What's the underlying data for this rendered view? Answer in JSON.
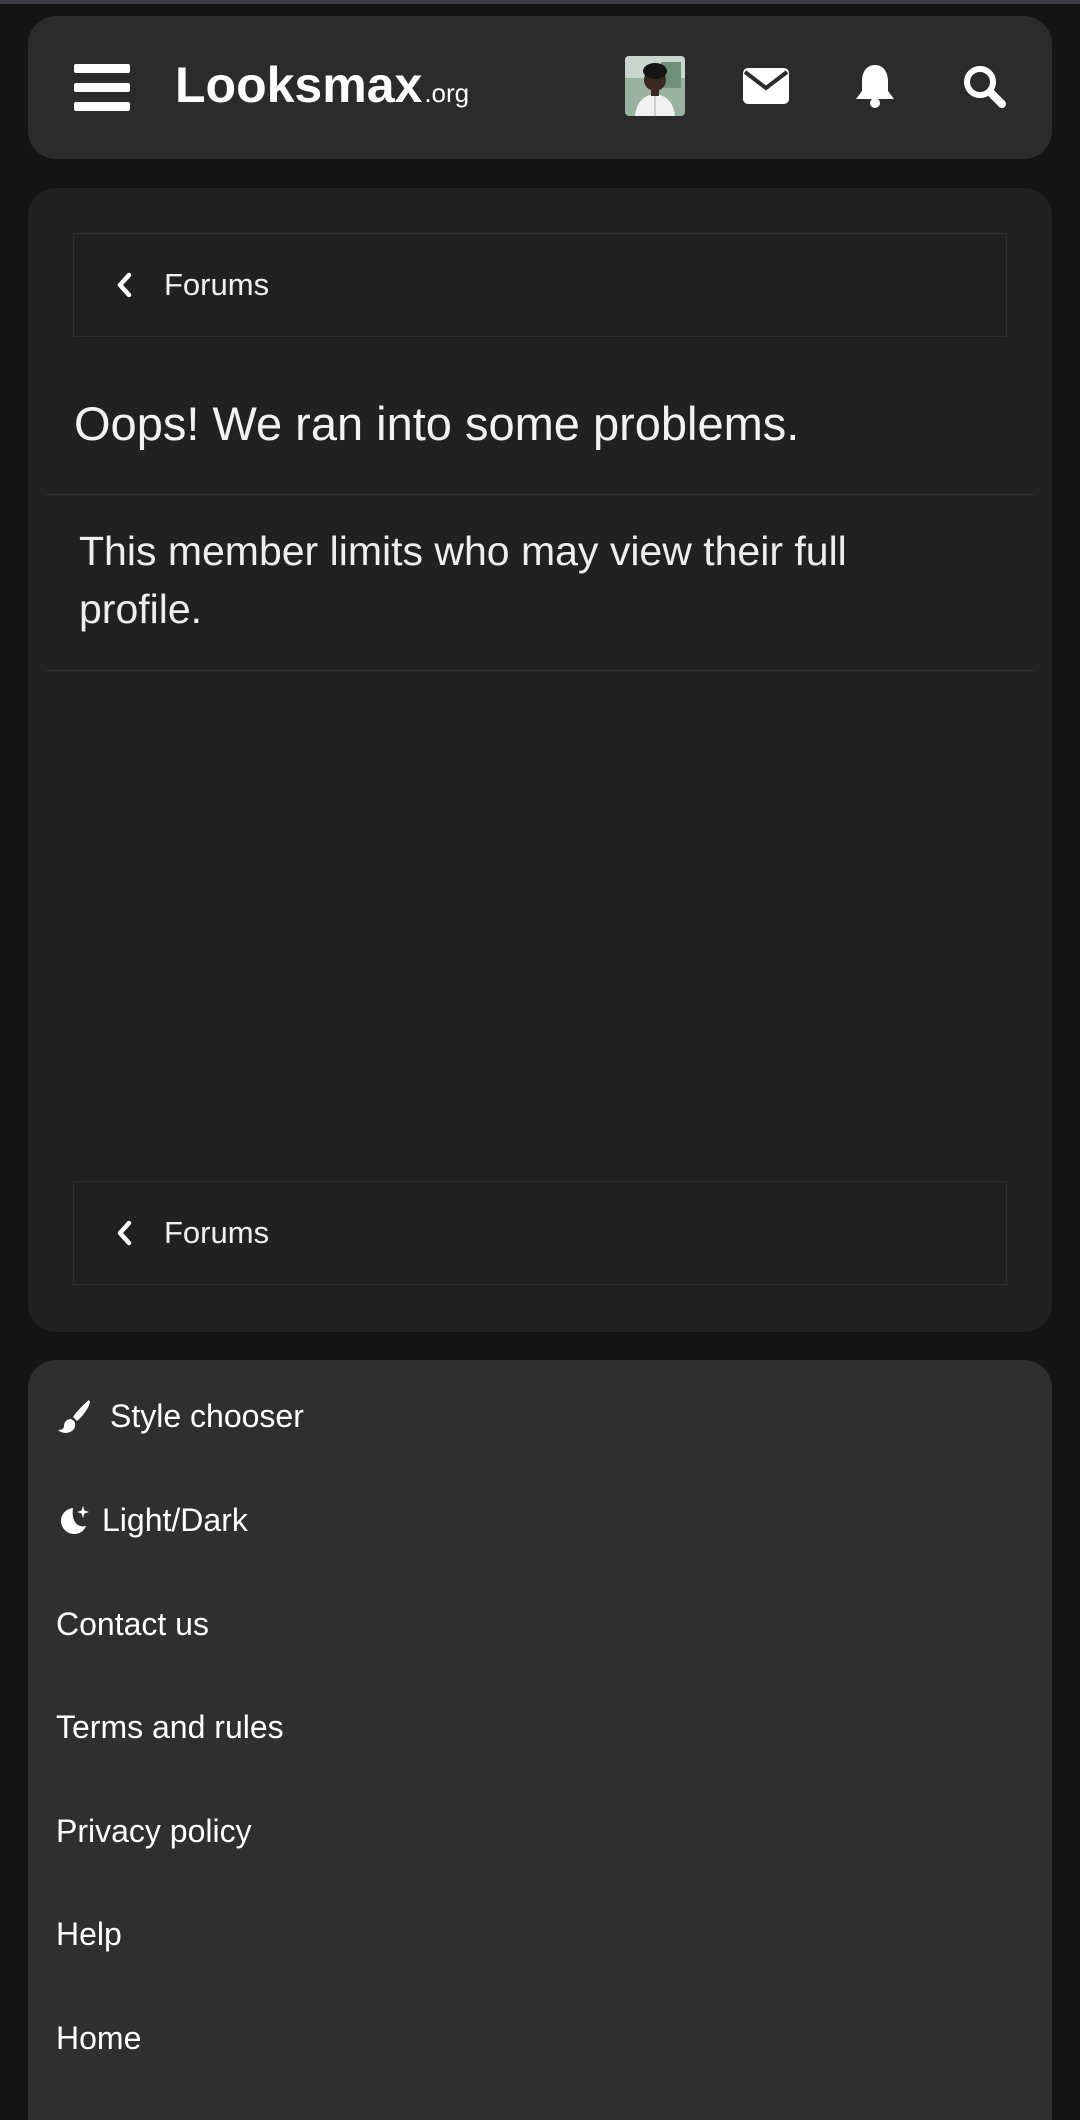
{
  "header": {
    "logo_main": "Lооksmax",
    "logo_tld": ".org",
    "icons": [
      "menu-icon",
      "avatar",
      "mail-icon",
      "bell-icon",
      "search-icon"
    ]
  },
  "breadcrumb": {
    "top_label": "Forums",
    "bottom_label": "Forums"
  },
  "error": {
    "title": "Oops! We ran into some problems.",
    "message": "This member limits who may view their full profile."
  },
  "footer": {
    "style_chooser": "Style chooser",
    "light_dark": "Light/Dark",
    "contact": "Contact us",
    "terms": "Terms and rules",
    "privacy": "Privacy policy",
    "help": "Help",
    "home": "Home"
  },
  "colors": {
    "page_bg": "#141414",
    "header_bg": "#2b2b2b",
    "card_bg": "#212121",
    "footer_bg": "#2f2f2f",
    "text": "#ffffff"
  }
}
